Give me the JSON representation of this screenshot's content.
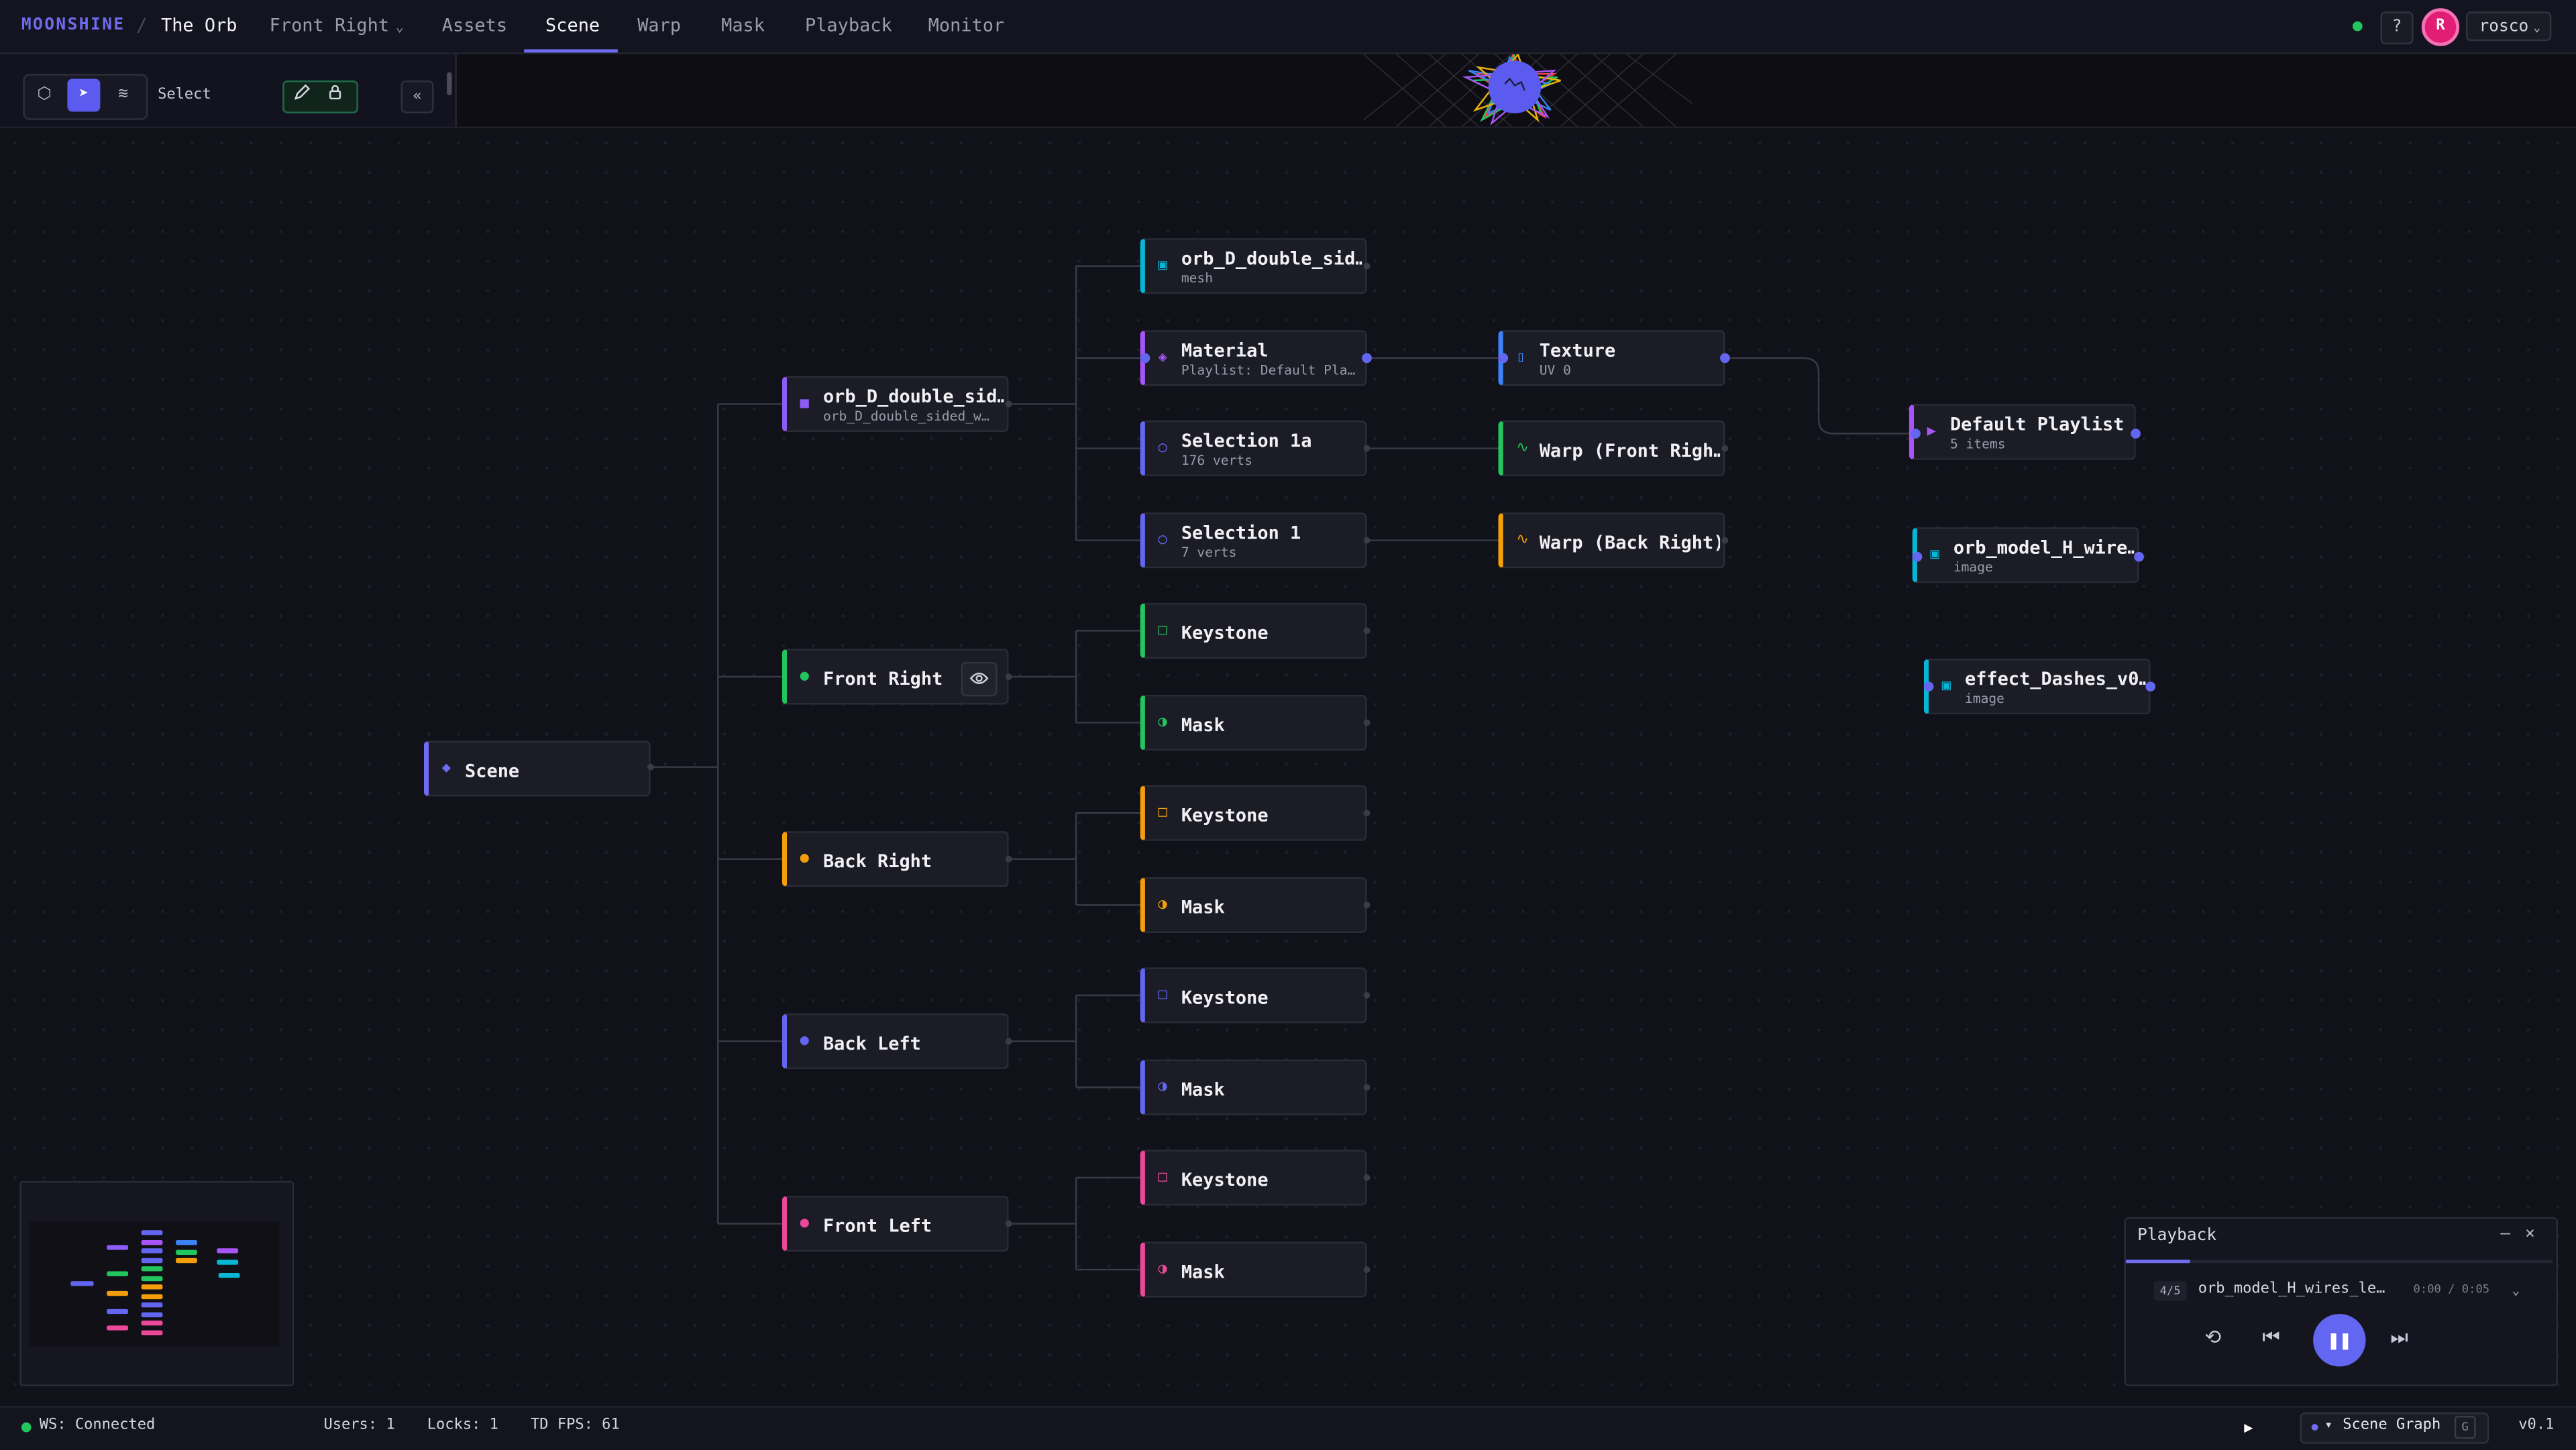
{
  "app": {
    "brand": "MOONSHINE",
    "separator": "/",
    "project": "The Orb",
    "view_selector": "Front Right",
    "tabs": [
      {
        "label": "Assets"
      },
      {
        "label": "Scene",
        "active": true
      },
      {
        "label": "Warp"
      },
      {
        "label": "Mask"
      },
      {
        "label": "Playback"
      },
      {
        "label": "Monitor"
      }
    ],
    "help_label": "?",
    "user_initial": "R",
    "user_name": "rosco"
  },
  "toolbar": {
    "tools": [
      {
        "name": "3d-view",
        "icon": "cube-icon",
        "glyph": "⬡"
      },
      {
        "name": "select",
        "icon": "cursor-arrow-icon",
        "glyph": "➤",
        "active": true
      },
      {
        "name": "warp",
        "icon": "waves-icon",
        "glyph": "≋"
      }
    ],
    "mode_label": "Select",
    "edit_icon": "pencil-icon",
    "lock_icon": "lock-icon",
    "collapse_label": "«"
  },
  "graph": {
    "nodes": {
      "scene": {
        "title": "Scene",
        "icon": "diamond-icon",
        "glyph": "◆",
        "color": "#6f6cf2"
      },
      "orb_root": {
        "title": "orb_D_double_sid…",
        "subtitle": "orb_D_double_sided_w…",
        "icon": "square-icon",
        "glyph": "■",
        "color": "#8b5cf6"
      },
      "front_right": {
        "title": "Front Right",
        "icon": "dot-icon",
        "glyph": "●",
        "color": "#22c55e"
      },
      "back_right": {
        "title": "Back Right",
        "icon": "dot-icon",
        "glyph": "●",
        "color": "#f59e0b"
      },
      "back_left": {
        "title": "Back Left",
        "icon": "dot-icon",
        "glyph": "●",
        "color": "#6366f1"
      },
      "front_left": {
        "title": "Front Left",
        "icon": "dot-icon",
        "glyph": "●",
        "color": "#ec4899"
      },
      "mesh": {
        "title": "orb_D_double_sid…",
        "subtitle": "mesh",
        "icon": "mesh-icon",
        "glyph": "▣",
        "color": "#06b6d4"
      },
      "material": {
        "title": "Material",
        "subtitle": "Playlist: Default Pla…",
        "icon": "material-icon",
        "glyph": "◈",
        "color": "#a855f7"
      },
      "selection_1a": {
        "title": "Selection 1a",
        "subtitle": "176 verts",
        "icon": "selection-icon",
        "glyph": "○",
        "color": "#6366f1"
      },
      "selection_1": {
        "title": "Selection 1",
        "subtitle": "7 verts",
        "icon": "selection-icon",
        "glyph": "○",
        "color": "#6366f1"
      },
      "fr_keystone": {
        "title": "Keystone",
        "icon": "keystone-icon",
        "glyph": "□",
        "color": "#22c55e"
      },
      "fr_mask": {
        "title": "Mask",
        "icon": "mask-icon",
        "glyph": "◑",
        "color": "#22c55e"
      },
      "br_keystone": {
        "title": "Keystone",
        "icon": "keystone-icon",
        "glyph": "□",
        "color": "#f59e0b"
      },
      "br_mask": {
        "title": "Mask",
        "icon": "mask-icon",
        "glyph": "◑",
        "color": "#f59e0b"
      },
      "bl_keystone": {
        "title": "Keystone",
        "icon": "keystone-icon",
        "glyph": "□",
        "color": "#6366f1"
      },
      "bl_mask": {
        "title": "Mask",
        "icon": "mask-icon",
        "glyph": "◑",
        "color": "#6366f1"
      },
      "fl_keystone": {
        "title": "Keystone",
        "icon": "keystone-icon",
        "glyph": "□",
        "color": "#ec4899"
      },
      "fl_mask": {
        "title": "Mask",
        "icon": "mask-icon",
        "glyph": "◑",
        "color": "#ec4899"
      },
      "texture": {
        "title": "Texture",
        "subtitle": "UV 0",
        "icon": "texture-icon",
        "glyph": "▯",
        "color": "#3b82f6"
      },
      "warp_fr": {
        "title": "Warp (Front Righ…",
        "icon": "warp-icon",
        "glyph": "∿",
        "color": "#22c55e"
      },
      "warp_br": {
        "title": "Warp (Back Right)",
        "icon": "warp-icon",
        "glyph": "∿",
        "color": "#f59e0b"
      },
      "playlist": {
        "title": "Default Playlist",
        "subtitle": "5 items",
        "icon": "play-icon",
        "glyph": "▶",
        "color": "#a855f7"
      },
      "img_orb": {
        "title": "orb_model_H_wire…",
        "subtitle": "image",
        "icon": "image-icon",
        "glyph": "▣",
        "color": "#06b6d4"
      },
      "img_dashes": {
        "title": "effect_Dashes_v0…",
        "subtitle": "image",
        "icon": "image-icon",
        "glyph": "▣",
        "color": "#06b6d4"
      }
    },
    "eye_icon": "eye-icon"
  },
  "playback": {
    "title": "Playback",
    "minimize": "–",
    "close": "×",
    "index": "4/5",
    "track": "orb_model_H_wires_le…",
    "time": "0:00 / 0:05",
    "progress": 0.15,
    "controls": {
      "loop": "⟲",
      "prev": "⏮",
      "pause": "❚❚",
      "next": "⏭"
    }
  },
  "status": {
    "ws": "WS: Connected",
    "users": "Users: 1",
    "locks": "Locks: 1",
    "fps": "TD FPS: 61",
    "view_label": "Scene Graph",
    "view_chev": "▾",
    "view_key": "G",
    "version": "v0.1"
  },
  "colors": {
    "accent": "#6f6cf2",
    "connected": "#22c55e",
    "avatar": "#e11d74"
  }
}
